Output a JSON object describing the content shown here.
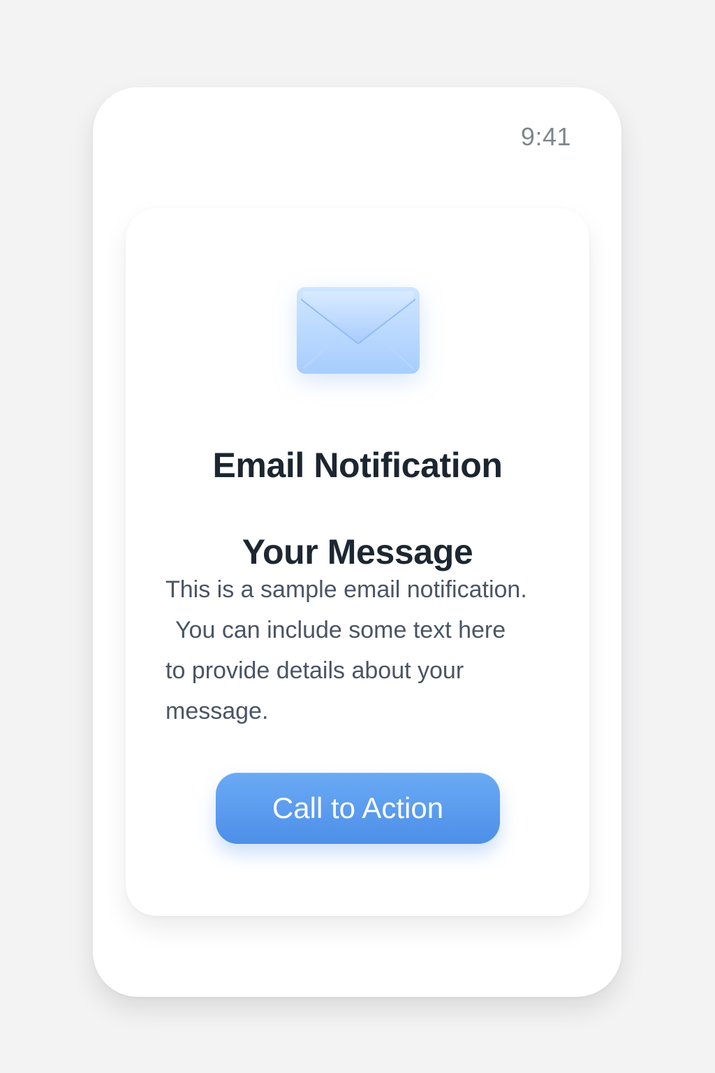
{
  "status_bar": {
    "time": "9:41"
  },
  "notification": {
    "icon": "envelope-icon",
    "title": "Email Notification",
    "subtitle": "Your Message",
    "body_lines": [
      "This is a sample email notification.",
      "You can include some text here",
      "to provide details about your",
      "message."
    ],
    "cta_label": "Call to Action"
  },
  "colors": {
    "background": "#f3f3f4",
    "card": "#ffffff",
    "title": "#1c2630",
    "body": "#4a5565",
    "time": "#80858c",
    "accent": "#4d8fe8"
  }
}
